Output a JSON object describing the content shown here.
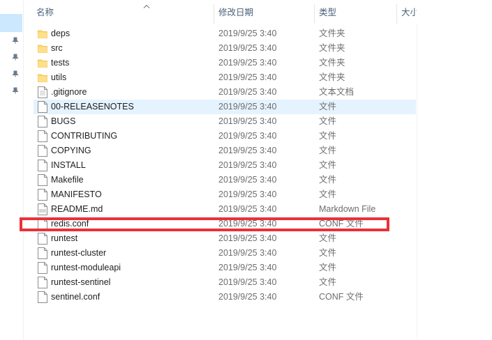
{
  "header": {
    "name": "名称",
    "date": "修改日期",
    "type": "类型",
    "size": "大小"
  },
  "files": [
    {
      "name": "deps",
      "date": "2019/9/25 3:40",
      "type": "文件夹",
      "icon": "folder-icon"
    },
    {
      "name": "src",
      "date": "2019/9/25 3:40",
      "type": "文件夹",
      "icon": "folder-icon"
    },
    {
      "name": "tests",
      "date": "2019/9/25 3:40",
      "type": "文件夹",
      "icon": "folder-icon"
    },
    {
      "name": "utils",
      "date": "2019/9/25 3:40",
      "type": "文件夹",
      "icon": "folder-icon"
    },
    {
      "name": ".gitignore",
      "date": "2019/9/25 3:40",
      "type": "文本文档",
      "icon": "text-file-icon"
    },
    {
      "name": "00-RELEASENOTES",
      "date": "2019/9/25 3:40",
      "type": "文件",
      "icon": "file-icon",
      "selected": true
    },
    {
      "name": "BUGS",
      "date": "2019/9/25 3:40",
      "type": "文件",
      "icon": "file-icon"
    },
    {
      "name": "CONTRIBUTING",
      "date": "2019/9/25 3:40",
      "type": "文件",
      "icon": "file-icon"
    },
    {
      "name": "COPYING",
      "date": "2019/9/25 3:40",
      "type": "文件",
      "icon": "file-icon"
    },
    {
      "name": "INSTALL",
      "date": "2019/9/25 3:40",
      "type": "文件",
      "icon": "file-icon"
    },
    {
      "name": "Makefile",
      "date": "2019/9/25 3:40",
      "type": "文件",
      "icon": "file-icon"
    },
    {
      "name": "MANIFESTO",
      "date": "2019/9/25 3:40",
      "type": "文件",
      "icon": "file-icon"
    },
    {
      "name": "README.md",
      "date": "2019/9/25 3:40",
      "type": "Markdown File",
      "icon": "markdown-file-icon"
    },
    {
      "name": "redis.conf",
      "date": "2019/9/25 3:40",
      "type": "CONF 文件",
      "icon": "file-icon",
      "highlighted": true
    },
    {
      "name": "runtest",
      "date": "2019/9/25 3:40",
      "type": "文件",
      "icon": "file-icon"
    },
    {
      "name": "runtest-cluster",
      "date": "2019/9/25 3:40",
      "type": "文件",
      "icon": "file-icon"
    },
    {
      "name": "runtest-moduleapi",
      "date": "2019/9/25 3:40",
      "type": "文件",
      "icon": "file-icon"
    },
    {
      "name": "runtest-sentinel",
      "date": "2019/9/25 3:40",
      "type": "文件",
      "icon": "file-icon"
    },
    {
      "name": "sentinel.conf",
      "date": "2019/9/25 3:40",
      "type": "CONF 文件",
      "icon": "file-icon"
    }
  ],
  "colors": {
    "selection": "#e5f3ff",
    "nav_selection": "#cce8ff",
    "highlight": "#e8323a",
    "folder": "#ffd866"
  }
}
